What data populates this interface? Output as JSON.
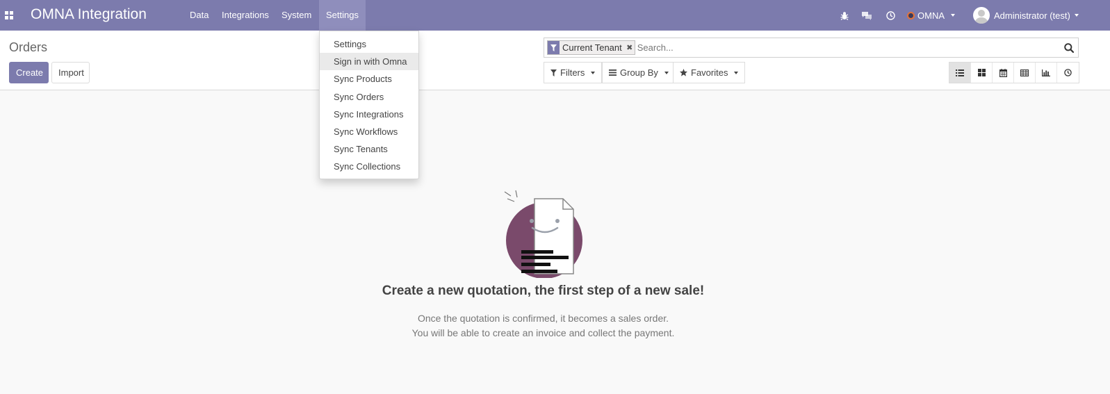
{
  "app": {
    "title": "OMNA Integration"
  },
  "navbar": {
    "menu": [
      {
        "label": "Data"
      },
      {
        "label": "Integrations"
      },
      {
        "label": "System"
      },
      {
        "label": "Settings",
        "active": true
      }
    ],
    "systray_icons": [
      "debug-icon",
      "chat-icon",
      "activity-clock-icon"
    ],
    "company": "OMNA",
    "user": "Administrator (test)"
  },
  "settings_menu": {
    "items": [
      {
        "label": "Settings"
      },
      {
        "label": "Sign in with Omna",
        "hover": true
      },
      {
        "label": "Sync Products"
      },
      {
        "label": "Sync Orders"
      },
      {
        "label": "Sync Integrations"
      },
      {
        "label": "Sync Workflows"
      },
      {
        "label": "Sync Tenants"
      },
      {
        "label": "Sync Collections"
      }
    ]
  },
  "control_panel": {
    "breadcrumb": "Orders",
    "create_label": "Create",
    "import_label": "Import",
    "search": {
      "facet": "Current Tenant",
      "placeholder": "Search..."
    },
    "filters_label": "Filters",
    "groupby_label": "Group By",
    "favorites_label": "Favorites",
    "views": [
      "list",
      "kanban",
      "calendar",
      "pivot",
      "graph",
      "activity"
    ],
    "active_view": "list"
  },
  "helper": {
    "title": "Create a new quotation, the first step of a new sale!",
    "line1": "Once the quotation is confirmed, it becomes a sales order.",
    "line2": "You will be able to create an invoice and collect the payment."
  },
  "colors": {
    "brand": "#7c7bad",
    "illustration_circle": "#7a4a6b"
  }
}
